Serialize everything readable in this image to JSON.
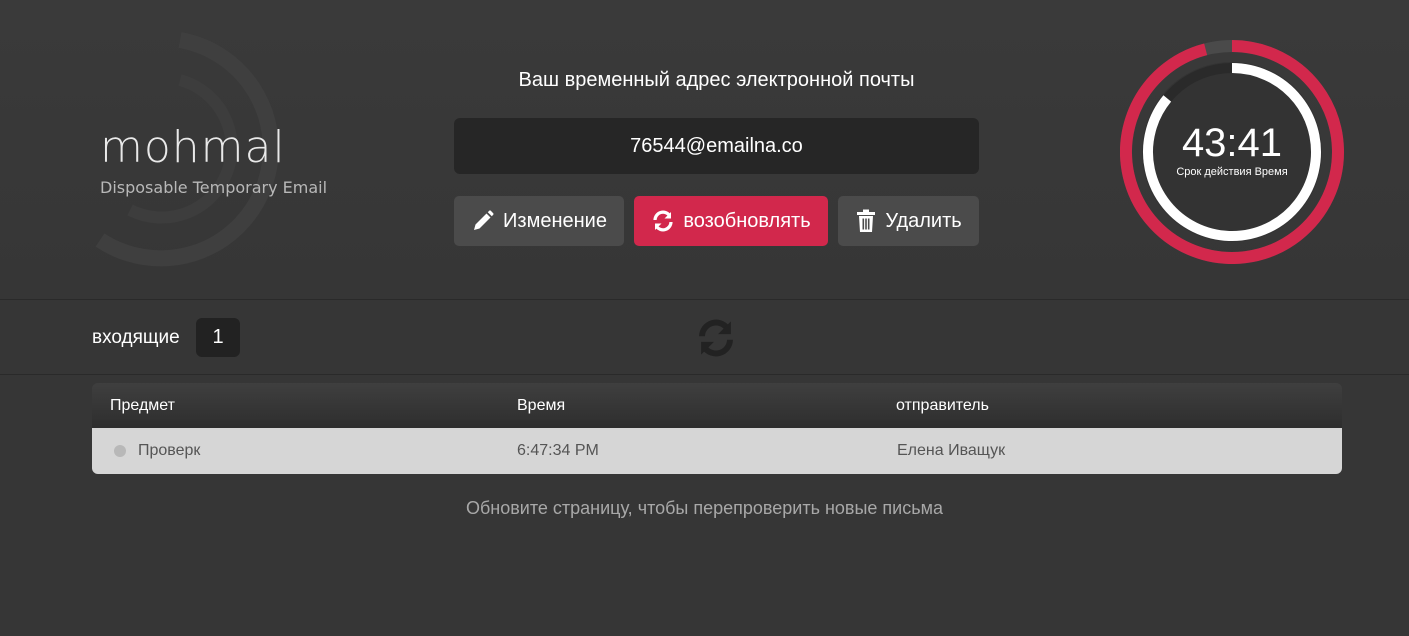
{
  "brand": {
    "logo_text": "mohmal",
    "tagline": "Disposable Temporary Email"
  },
  "address": {
    "title": "Ваш временный адрес электронной почты",
    "email": "76544@emailna.co"
  },
  "actions": {
    "edit_label": "Изменение",
    "renew_label": "возобновлять",
    "delete_label": "Удалить"
  },
  "timer": {
    "time": "43:41",
    "label": "Срок действия Время",
    "remaining_fraction": 0.86,
    "outer_fraction": 0.96
  },
  "inbox": {
    "label": "входящие",
    "count": "1"
  },
  "table": {
    "headers": {
      "subject": "Предмет",
      "time": "Время",
      "sender": "отправитель"
    },
    "rows": [
      {
        "subject": "Проверк",
        "time": "6:47:34 PM",
        "sender": "Елена Иващук"
      }
    ]
  },
  "hint": "Обновите страницу, чтобы перепроверить новые письма",
  "colors": {
    "accent": "#d2284c",
    "background": "#363636",
    "button_gray": "#4b4b4b"
  },
  "icons": {
    "edit": "pencil-icon",
    "renew": "refresh-icon",
    "delete": "trash-icon",
    "inbox_refresh": "refresh-icon"
  }
}
